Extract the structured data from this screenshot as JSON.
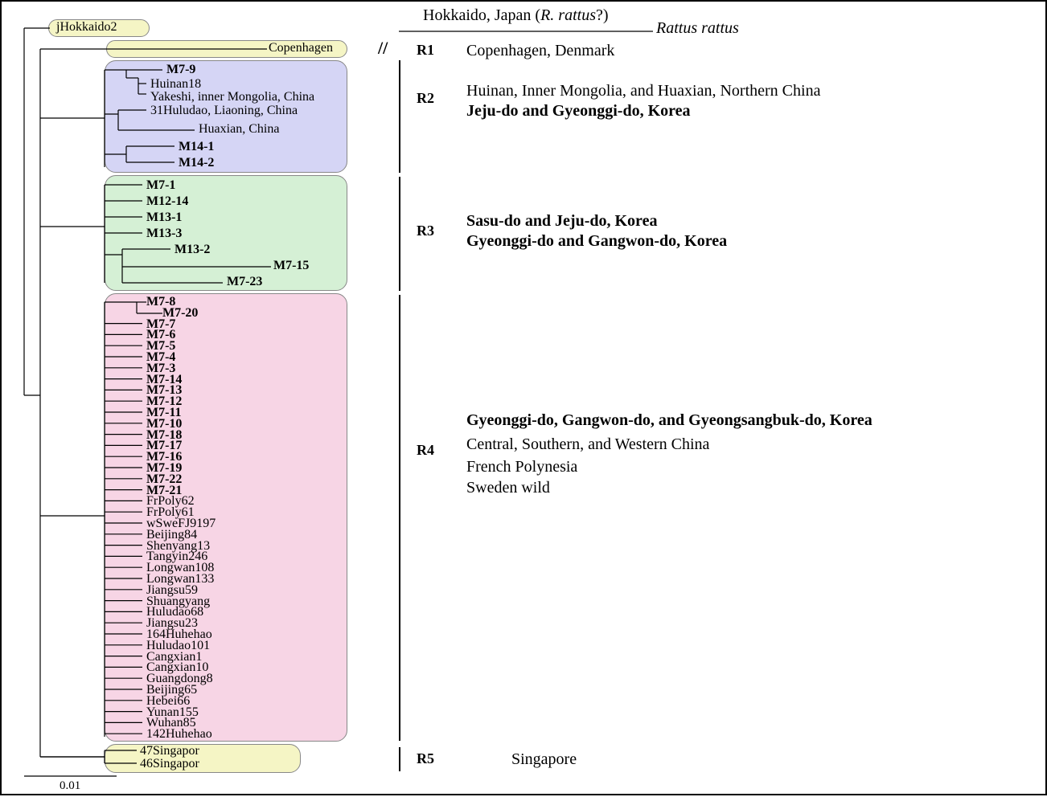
{
  "outgroup": {
    "taxon": "jHokkaido2",
    "annotation_prefix": "Hokkaido, Japan (",
    "annotation_sp": "R. rattus",
    "annotation_suffix": "?)",
    "root_label": "Rattus rattus"
  },
  "clades": {
    "R1": {
      "label": "R1",
      "taxa": [
        "Copenhagen"
      ],
      "annotations": [
        {
          "text": "Copenhagen, Denmark",
          "bold": false
        }
      ]
    },
    "R2": {
      "label": "R2",
      "taxa_bold_top": [
        "M7-9"
      ],
      "taxa_plain": [
        "Huinan18",
        "Yakeshi, inner Mongolia, China",
        "31Huludao, Liaoning, China",
        "Huaxian, China"
      ],
      "taxa_bold_bottom": [
        "M14-1",
        "M14-2"
      ],
      "annotations": [
        {
          "text": "Huinan, Inner Mongolia, and Huaxian, Northern China",
          "bold": false
        },
        {
          "text": "Jeju-do and Gyeonggi-do, Korea",
          "bold": true
        }
      ]
    },
    "R3": {
      "label": "R3",
      "taxa_bold": [
        "M7-1",
        "M12-14",
        "M13-1",
        "M13-3",
        "M13-2",
        "M7-15",
        "M7-23"
      ],
      "annotations": [
        {
          "text": "Sasu-do and Jeju-do, Korea",
          "bold": true
        },
        {
          "text": "Gyeonggi-do and Gangwon-do, Korea",
          "bold": true
        }
      ]
    },
    "R4": {
      "label": "R4",
      "taxa_bold": [
        "M7-8",
        "M7-20",
        "M7-7",
        "M7-6",
        "M7-5",
        "M7-4",
        "M7-3",
        "M7-14",
        "M7-13",
        "M7-12",
        "M7-11",
        "M7-10",
        "M7-18",
        "M7-17",
        "M7-16",
        "M7-19",
        "M7-22",
        "M7-21"
      ],
      "taxa_plain": [
        "FrPoly62",
        "FrPoly61",
        "wSweFJ9197",
        "Beijing84",
        "Shenyang13",
        "Tangyin246",
        "Longwan108",
        "Longwan133",
        "Jiangsu59",
        "Shuangyang",
        "Huludao68",
        "Jiangsu23",
        "164Huhehao",
        "Huludao101",
        "Cangxian1",
        "Cangxian10",
        "Guangdong8",
        "Beijing65",
        "Hebei66",
        "Yunan155",
        "Wuhan85",
        "142Huhehao"
      ],
      "annotations": [
        {
          "text": "Gyeonggi-do, Gangwon-do, and Gyeongsangbuk-do, Korea",
          "bold": true
        },
        {
          "text": "Central, Southern, and Western China",
          "bold": false
        },
        {
          "text": "French Polynesia",
          "bold": false
        },
        {
          "text": "Sweden wild",
          "bold": false
        }
      ]
    },
    "R5": {
      "label": "R5",
      "taxa": [
        "47Singapor",
        "46Singapor"
      ],
      "annotations": [
        {
          "text": "Singapore",
          "bold": false
        }
      ]
    }
  },
  "scale": "0.01",
  "break_symbol": "//"
}
